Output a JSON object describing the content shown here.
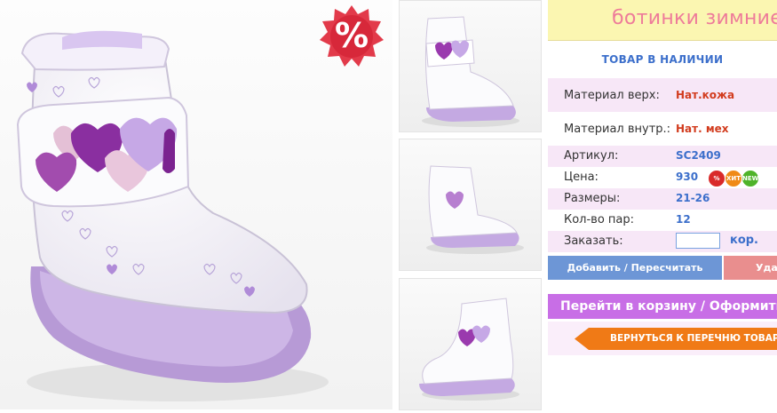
{
  "product": {
    "title": "ботинки зимние",
    "stock_status": "ТОВАР В НАЛИЧИИ",
    "sale_badge": "%",
    "specs": [
      {
        "label": "Материал верх:",
        "value": "Нат.кожа"
      },
      {
        "label": "Материал внутр.:",
        "value": "Нат. мех"
      },
      {
        "label": "Артикул:",
        "value": "SC2409"
      },
      {
        "label": "Цена:",
        "value": "930"
      },
      {
        "label": "Размеры:",
        "value": "21-26"
      },
      {
        "label": "Кол-во пар:",
        "value": "12"
      }
    ],
    "price_badges": [
      "%",
      "ХИТ",
      "NEW"
    ],
    "order": {
      "label": "Заказать:",
      "value": "",
      "unit": "кор."
    }
  },
  "buttons": {
    "add": "Добавить / Пересчитать",
    "delete": "Уда",
    "cart": "Перейти в корзину / Оформить",
    "back": "ВЕРНУТЬСЯ К ПЕРЕЧНЮ ТОВАРА"
  },
  "colors": {
    "title_bg": "#fbf6b1",
    "title_text": "#ee7b9a",
    "link_blue": "#3c6fcb",
    "accent_red": "#d23c1e",
    "add_button": "#6d96d6",
    "cart_button": "#c86ee6",
    "back_button": "#f07a16"
  }
}
